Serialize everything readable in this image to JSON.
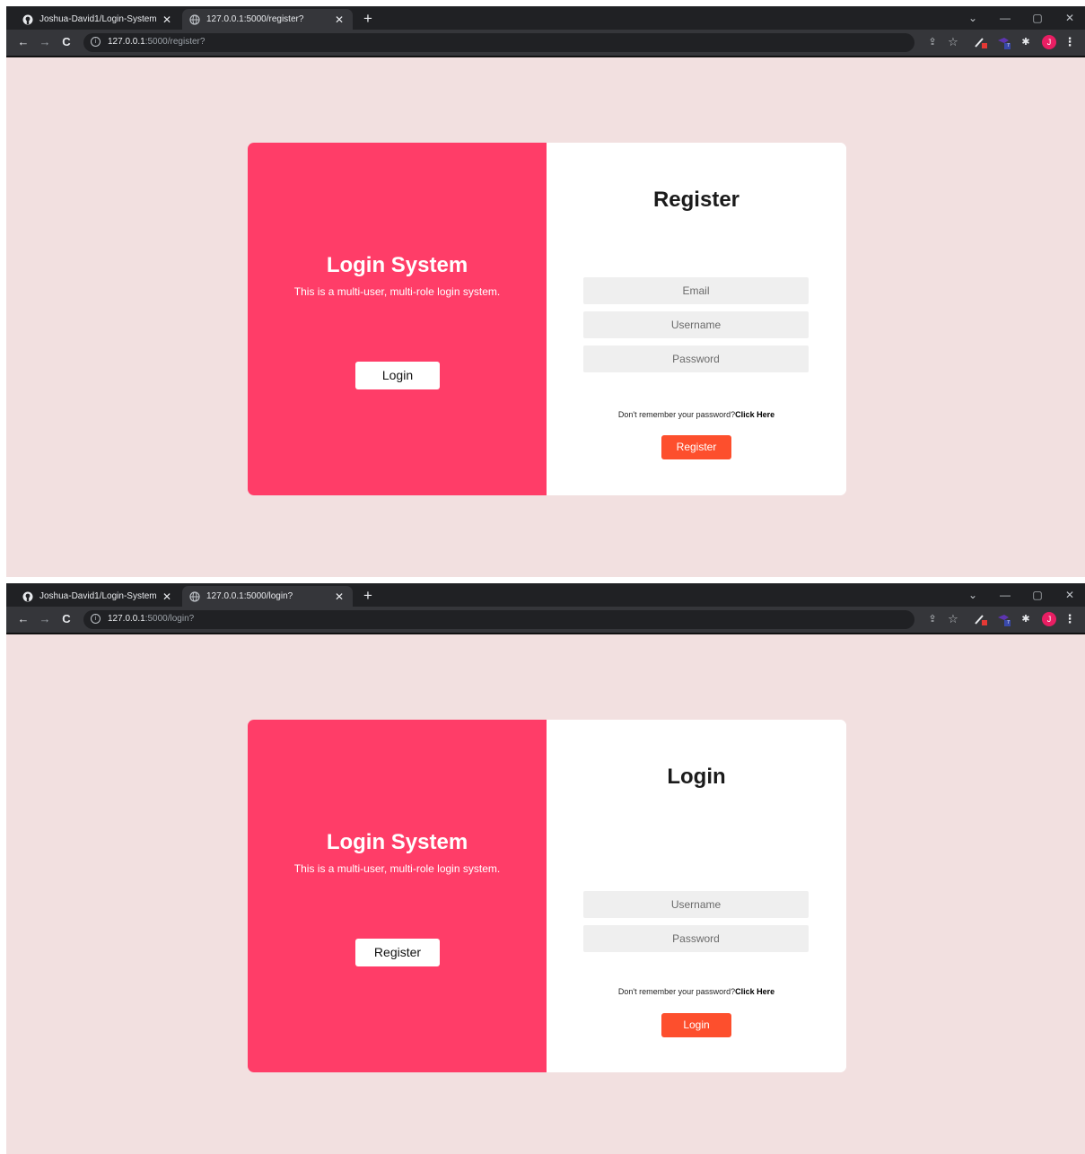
{
  "colors": {
    "page_background": "#f2e0e0",
    "brand_panel": "#ff3d68",
    "submit_button": "#fd4f2d",
    "field_background": "#efefef",
    "browser_chrome": "#202124",
    "avatar": "#e91e63"
  },
  "screens": [
    {
      "browser": {
        "tabs": [
          {
            "title": "Joshua-David1/Login-System",
            "icon": "github-icon"
          },
          {
            "title": "127.0.0.1:5000/register?",
            "icon": "globe-icon"
          }
        ],
        "address": {
          "host": "127.0.0.1",
          "path": ":5000/register?"
        },
        "avatar_letter": "J",
        "extension_badge": "7"
      },
      "brand": {
        "title": "Login System",
        "subtitle": "This is a multi-user, multi-role login system.",
        "switch_button": "Login"
      },
      "form": {
        "title": "Register",
        "fields": [
          {
            "placeholder": "Email"
          },
          {
            "placeholder": "Username"
          },
          {
            "placeholder": "Password"
          }
        ],
        "forgot_text": "Don't remember your password?",
        "forgot_link": "Click Here",
        "submit": "Register"
      }
    },
    {
      "browser": {
        "tabs": [
          {
            "title": "Joshua-David1/Login-System",
            "icon": "github-icon"
          },
          {
            "title": "127.0.0.1:5000/login?",
            "icon": "globe-icon"
          }
        ],
        "address": {
          "host": "127.0.0.1",
          "path": ":5000/login?"
        },
        "avatar_letter": "J",
        "extension_badge": "7"
      },
      "brand": {
        "title": "Login System",
        "subtitle": "This is a multi-user, multi-role login system.",
        "switch_button": "Register"
      },
      "form": {
        "title": "Login",
        "fields": [
          {
            "placeholder": "Username"
          },
          {
            "placeholder": "Password"
          }
        ],
        "forgot_text": "Don't remember your password?",
        "forgot_link": "Click Here",
        "submit": "Login"
      }
    }
  ]
}
